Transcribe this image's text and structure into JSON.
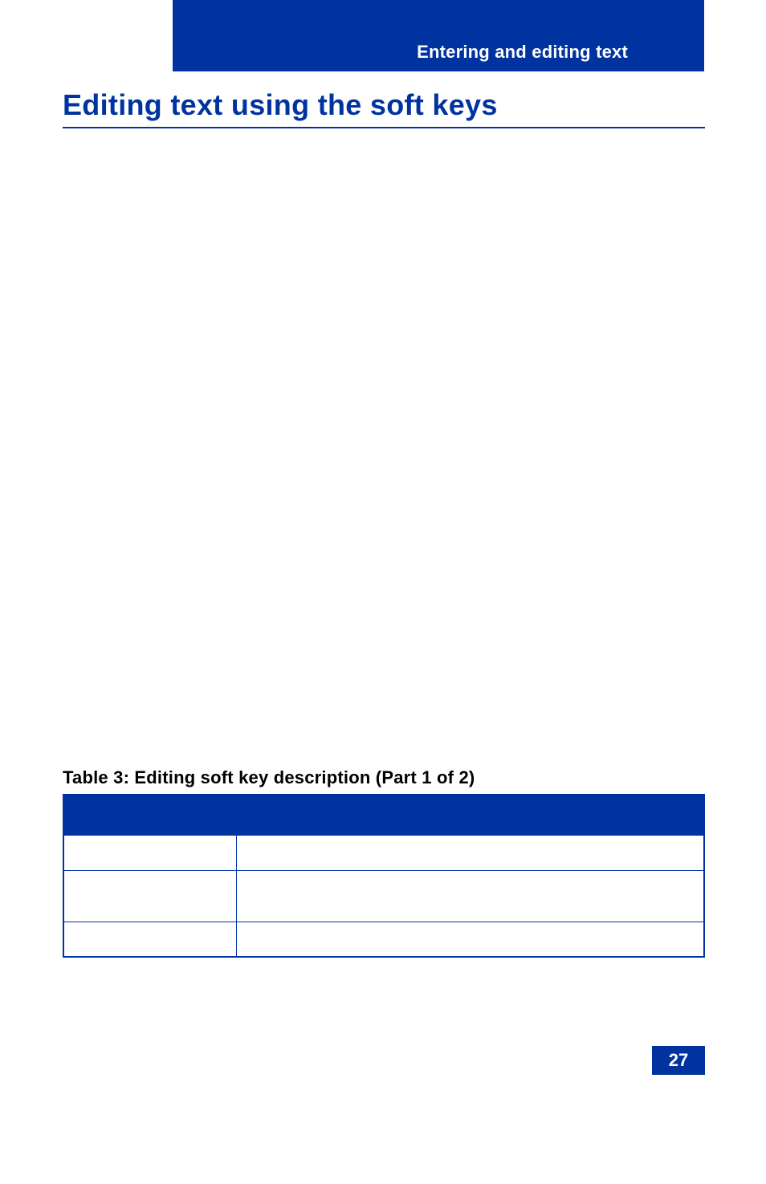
{
  "header": {
    "breadcrumb": "Entering and editing text"
  },
  "section": {
    "heading": "Editing text using the soft keys"
  },
  "table": {
    "caption": "Table 3: Editing soft key description (Part 1 of 2)",
    "headers": [
      "",
      ""
    ],
    "rows": [
      [
        "",
        ""
      ],
      [
        "",
        ""
      ],
      [
        "",
        ""
      ]
    ]
  },
  "page_number": "27"
}
